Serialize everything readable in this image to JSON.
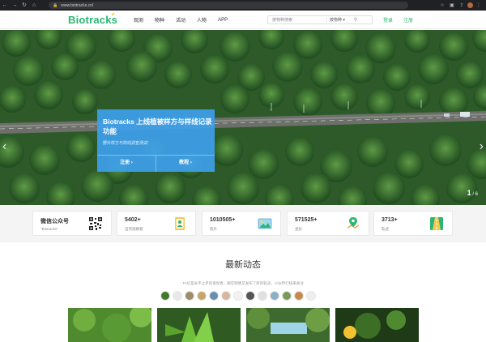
{
  "browser": {
    "url": "www.biotracks.cn/"
  },
  "header": {
    "logo_text": "Biotracks",
    "nav": [
      "观测",
      "物种",
      "活动",
      "人物",
      "APP"
    ],
    "search_placeholder": "按物种搜索",
    "search_type": "按物种 ▾",
    "login_label": "登录",
    "register_label": "注册"
  },
  "hero": {
    "title": "Biotracks 上线植被样方与样线记录功能",
    "subtitle": "野外样方与样线调查测试!",
    "register_btn": "注册 ›",
    "tutorial_btn": "教程 ›",
    "page_current": "1",
    "page_total": "/ 6",
    "arrow_left": "‹",
    "arrow_right": "›"
  },
  "stats": [
    {
      "value": "微信公众号",
      "label": "\"Biotracks\"",
      "icon": "qr-code-icon"
    },
    {
      "value": "5402+",
      "label": "自然观察者",
      "icon": "observer-badge-icon"
    },
    {
      "value": "1010505+",
      "label": "照片",
      "icon": "photo-icon"
    },
    {
      "value": "571525+",
      "label": "坐标",
      "icon": "map-pin-icon"
    },
    {
      "value": "3713+",
      "label": "轨迹",
      "icon": "track-road-icon"
    }
  ],
  "latest": {
    "title": "最新动态",
    "subtitle": "TA们是永不止步的发现者，跟在明明又发布了新的轨迹，小伙伴们快来关注"
  },
  "colors": {
    "brand": "#2bb673",
    "hero_card": "#3ea0eb"
  }
}
